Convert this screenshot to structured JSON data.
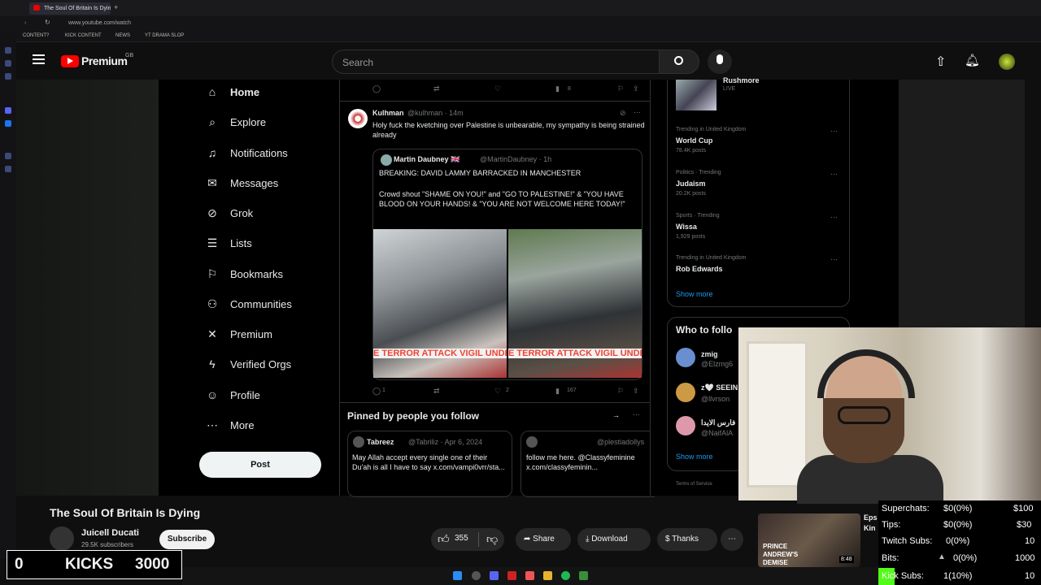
{
  "browser": {
    "tab_title": "The Soul Of Britain Is Dying",
    "url": "www.youtube.com/watch",
    "bookmarks": [
      "CONTENT?",
      "KICK CONTENT",
      "NEWS",
      "YT DRAMA SLOP"
    ]
  },
  "youtube": {
    "brand": "Premium",
    "region": "GB",
    "search_placeholder": "Search"
  },
  "x_nav": {
    "items": [
      "Home",
      "Explore",
      "Notifications",
      "Messages",
      "Grok",
      "Lists",
      "Bookmarks",
      "Communities",
      "Premium",
      "Verified Orgs",
      "Profile",
      "More"
    ],
    "post": "Post"
  },
  "tweet": {
    "name": "Kulhman",
    "handle": "@kulhman · 14m",
    "text": "Holy fuck the kvetching over Palestine is unbearable, my sympathy is being strained already",
    "quote_name": "Martin Daubney 🇬🇧",
    "quote_handle": "@MartinDaubney · 1h",
    "quote_line1": "BREAKING: DAVID LAMMY BARRACKED IN MANCHESTER",
    "quote_line2": "Crowd shout \"SHAME ON YOU!\" and \"GO TO PALESTINE!\" & \"YOU HAVE BLOOD ON YOUR HANDS! & \"YOU ARE NOT WELCOME HERE TODAY!\"",
    "banner": "E TERROR ATTACK VIGIL UNDE",
    "replies": "1",
    "likes": "2",
    "views": "167",
    "top_views": "8"
  },
  "pinned": {
    "title": "Pinned by people you follow",
    "cards": [
      {
        "name": "Tabreez",
        "handle": "@Tabriliz · Apr 6, 2024",
        "text": "May Allah accept every single one of their Du'ah is all I have to say x.com/vampi0vrr/sta..."
      },
      {
        "handle": "@plestiadollys",
        "text": "follow me here. @Classyfeminine x.com/classyfeminin..."
      }
    ]
  },
  "sidebar": {
    "live": "Rushmore",
    "live_tag": "LIVE",
    "trends": [
      {
        "cat": "Trending in United Kingdom",
        "name": "World Cup",
        "count": "78.4K posts"
      },
      {
        "cat": "Politics · Trending",
        "name": "Judaism",
        "count": "20.2K posts"
      },
      {
        "cat": "Sports · Trending",
        "name": "Wissa",
        "count": "1,929 posts"
      },
      {
        "cat": "Trending in United Kingdom",
        "name": "Rob Edwards",
        "count": ""
      }
    ],
    "show_more": "Show more",
    "who_title": "Who to follo",
    "follows": [
      {
        "name": "zmig",
        "handle": "@Elzmg6"
      },
      {
        "name": "z🤍 SEEIN",
        "handle": "@llvrson"
      },
      {
        "name": "فارس الايدا",
        "handle": "@NaifAlA"
      }
    ],
    "show_more2": "Show more",
    "terms": "Terms of Service"
  },
  "video": {
    "title": "The Soul Of Britain Is Dying",
    "channel": "Juicell Ducati",
    "subscribers": "29.5K subscribers",
    "subscribe": "Subscribe",
    "likes": "355",
    "share": "Share",
    "download": "Download",
    "thanks": "Thanks",
    "up_next_title": "PRINCE ANDREW'S DEMISE",
    "up_next_dur": "8:48",
    "up_next_side": "Eps",
    "up_next_side2": "Kin"
  },
  "stats": {
    "rows": [
      {
        "label": "Superchats:",
        "val": "$0(0%)",
        "goal": "$100"
      },
      {
        "label": "Tips:",
        "val": "$0(0%)",
        "goal": "$30"
      },
      {
        "label": "Twitch Subs:",
        "val": "0(0%)",
        "goal": "10"
      },
      {
        "label": "Bits:",
        "val": "0(0%)",
        "goal": "1000"
      },
      {
        "label": "Kick Subs:",
        "val": "1(10%)",
        "goal": "10"
      }
    ]
  },
  "kicks": {
    "current": "0",
    "label": "KICKS",
    "goal": "3000"
  }
}
